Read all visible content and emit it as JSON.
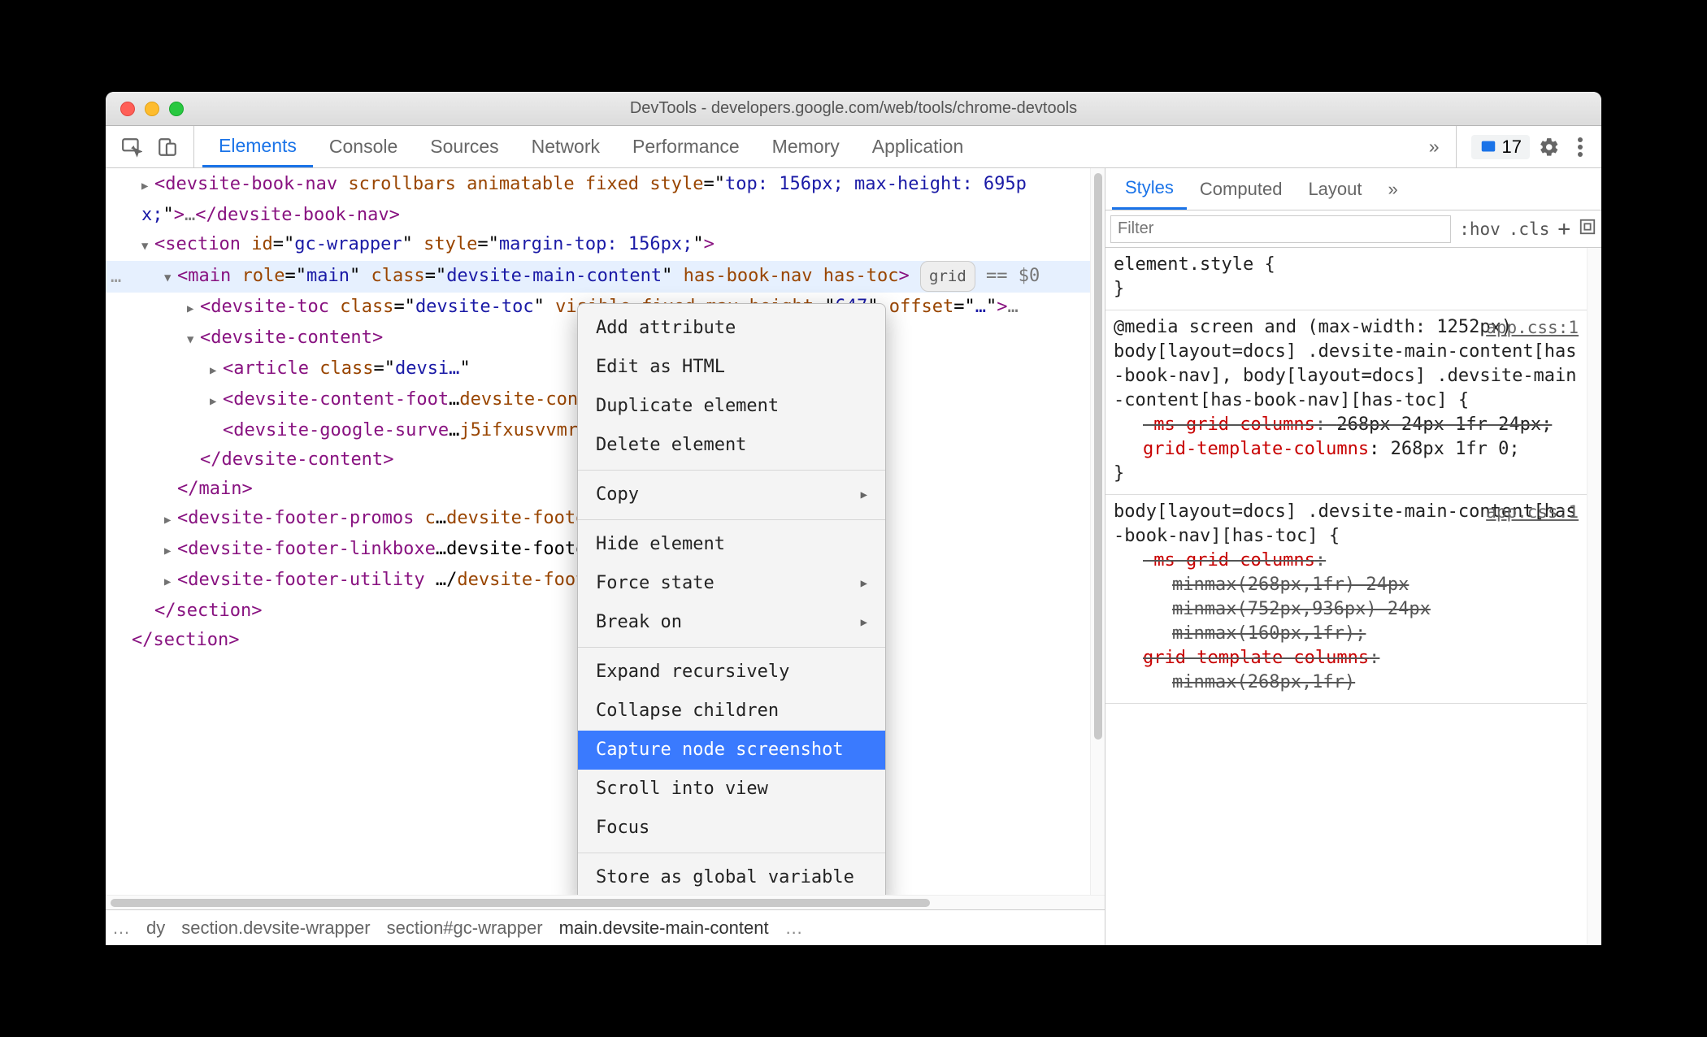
{
  "window": {
    "title": "DevTools - developers.google.com/web/tools/chrome-devtools"
  },
  "toolbar": {
    "tabs": [
      "Elements",
      "Console",
      "Sources",
      "Network",
      "Performance",
      "Memory",
      "Application"
    ],
    "overflow": "»",
    "issues_count": "17"
  },
  "context_menu": {
    "groups": [
      [
        "Add attribute",
        "Edit as HTML",
        "Duplicate element",
        "Delete element"
      ],
      [
        {
          "label": "Copy",
          "sub": true
        }
      ],
      [
        "Hide element",
        {
          "label": "Force state",
          "sub": true
        },
        {
          "label": "Break on",
          "sub": true
        }
      ],
      [
        "Expand recursively",
        "Collapse children",
        "Capture node screenshot",
        "Scroll into view",
        "Focus"
      ],
      [
        "Store as global variable"
      ]
    ],
    "highlighted": "Capture node screenshot"
  },
  "dom": {
    "gutter": "…",
    "lines": [
      {
        "indent": 1,
        "arrow": "right",
        "html": "<devsite-book-nav scrollbars animatable fixed style=\"top: 156px; max-height: 695px;\">…</devsite-book-nav>"
      },
      {
        "indent": 1,
        "arrow": "down",
        "html": "<section id=\"gc-wrapper\" style=\"margin-top: 156px;\">"
      },
      {
        "indent": 2,
        "arrow": "down",
        "hl": true,
        "html": "<main role=\"main\" class=\"devsite-main-content\" has-book-nav has-toc>",
        "badge": "grid",
        "eq": "== $0"
      },
      {
        "indent": 3,
        "arrow": "right",
        "html": "<devsite-toc class=\"devsite-toc\" visible fixed max-height=\"647\" offset=\"…\">…"
      },
      {
        "indent": 3,
        "arrow": "down",
        "html": "<devsite-content>"
      },
      {
        "indent": 4,
        "arrow": "right",
        "html": "<article class=\"devsi…"
      },
      {
        "indent": 4,
        "arrow": "right",
        "html": "<devsite-content-foot…devsite-content-footer>"
      },
      {
        "indent": 4,
        "arrow": "none",
        "html": "<devsite-google-surve…j5ifxusvvmr4pp6ae5lwrctq\"></devsit…"
      },
      {
        "indent": 3,
        "arrow": "none",
        "close": true,
        "html": "</devsite-content>"
      },
      {
        "indent": 2,
        "arrow": "none",
        "close": true,
        "html": "</main>"
      },
      {
        "indent": 2,
        "arrow": "right",
        "html": "<devsite-footer-promos c…devsite-footer-promos>"
      },
      {
        "indent": 2,
        "arrow": "right",
        "html": "<devsite-footer-linkboxe…</devsite-footer-linkboxes>"
      },
      {
        "indent": 2,
        "arrow": "right",
        "html": "<devsite-footer-utility …/devsite-footer-utility>"
      },
      {
        "indent": 1,
        "arrow": "none",
        "close": true,
        "html": "</section>"
      },
      {
        "indent": 0,
        "arrow": "none",
        "close": true,
        "html": "</section>"
      }
    ]
  },
  "breadcrumbs": {
    "left_ellipsis": "…",
    "items": [
      "dy",
      "section.devsite-wrapper",
      "section#gc-wrapper",
      "main.devsite-main-content"
    ],
    "right_ellipsis": "…"
  },
  "styles": {
    "subtabs": [
      "Styles",
      "Computed",
      "Layout"
    ],
    "overflow": "»",
    "filter_placeholder": "Filter",
    "filter_ctrls": {
      "hov": ":hov",
      "cls": ".cls",
      "plus": "+"
    },
    "rules": [
      {
        "selector": "element.style",
        "open": "{",
        "close": "}",
        "decls": []
      },
      {
        "media": "@media screen and (max-width: 1252px)",
        "source": "app.css:1",
        "selector": "body[layout=docs] .devsite-main-content[has-book-nav], body[layout=docs] .devsite-main-content[has-book-nav][has-toc]",
        "open": "{",
        "close": "}",
        "decls": [
          {
            "prop": "-ms-grid-columns",
            "val": "268px 24px 1fr 24px;",
            "struck": true
          },
          {
            "prop": "grid-template-columns",
            "val": "268px 1fr 0;",
            "struck": false
          }
        ]
      },
      {
        "source": "app.css:1",
        "selector": "body[layout=docs] .devsite-main-content[has-book-nav][has-toc]",
        "open": "{",
        "close": "",
        "decls": [
          {
            "prop": "-ms-grid-columns",
            "val": "",
            "struck": true
          },
          {
            "prop": "",
            "val": "minmax(268px,1fr) 24px",
            "struck": true,
            "cont": true
          },
          {
            "prop": "",
            "val": "minmax(752px,936px) 24px",
            "struck": true,
            "cont": true
          },
          {
            "prop": "",
            "val": "minmax(160px,1fr);",
            "struck": true,
            "cont": true
          },
          {
            "prop": "grid-template-columns",
            "val": "",
            "struck": true
          },
          {
            "prop": "",
            "val": "minmax(268px,1fr)",
            "struck": true,
            "cont": true
          }
        ]
      }
    ]
  }
}
